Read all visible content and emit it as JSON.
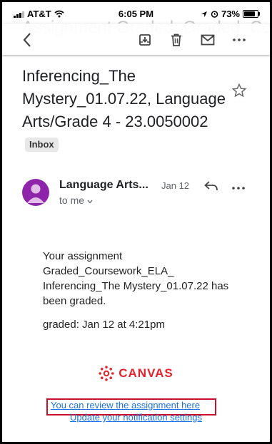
{
  "status_bar": {
    "carrier": "AT&T",
    "time": "6:05 PM",
    "battery": "73%"
  },
  "header": {
    "scrolled_title": "Assignment Graded: Graded_Coursework_ELA_"
  },
  "email": {
    "subject": "Inferencing_The Mystery_01.07.22, Language Arts/Grade 4  - 23.0050002",
    "label_badge": "Inbox",
    "sender": "Language Arts...",
    "recipient": "to me",
    "date": "Jan 12",
    "body_line1": "Your assignment Graded_Coursework_ELA_ Inferencing_The Mystery_01.07.22 has been graded.",
    "graded_line": "graded: Jan 12 at 4:21pm",
    "logo_text": "CANVAS",
    "review_link": "You can review the assignment here",
    "notification_link": "Update your notification settings"
  },
  "colors": {
    "avatar": "#8e24aa",
    "link": "#1a73e8",
    "brand": "#e4242d",
    "highlight_box": "#c8102e"
  }
}
